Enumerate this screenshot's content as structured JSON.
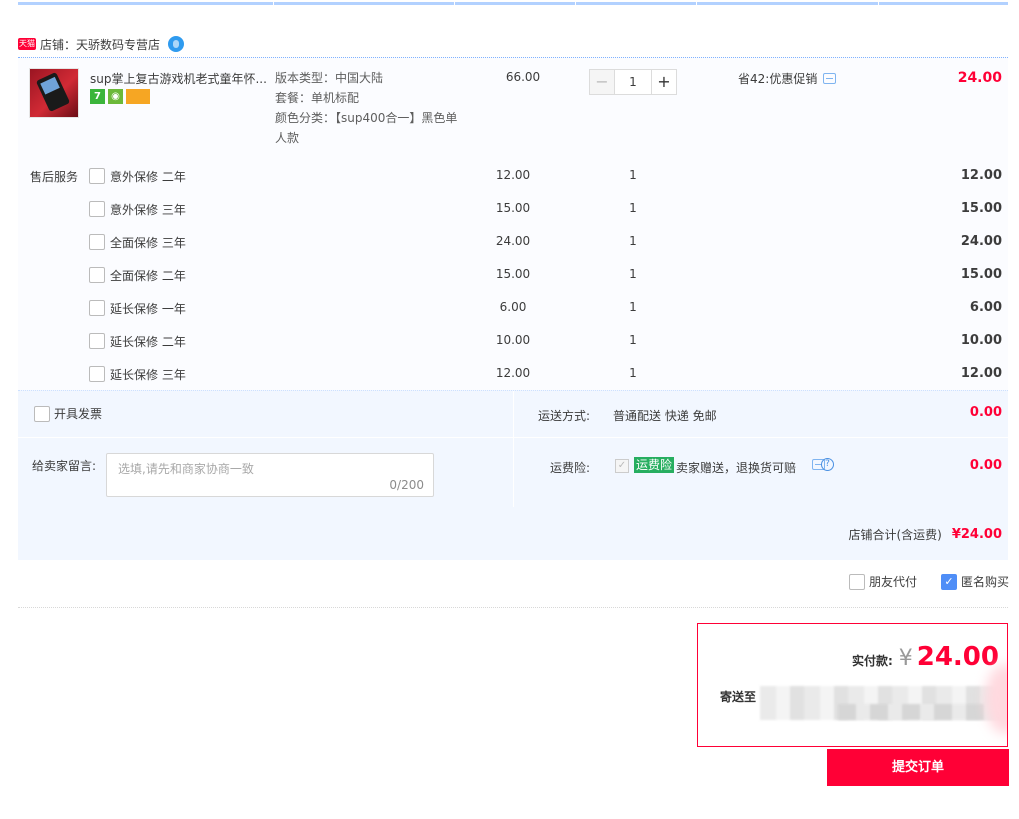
{
  "shop": {
    "prefix": "店铺：",
    "name": "天骄数码专营店",
    "tmall_badge": "天猫"
  },
  "item": {
    "title": "sup掌上复古游戏机老式童年怀...",
    "badges": [
      "7",
      "shield",
      "card"
    ],
    "props": [
      "版本类型：中国大陆",
      "套餐：单机标配",
      "颜色分类：【sup400合一】黑色单人款"
    ],
    "price": "66.00",
    "qty": "1",
    "qty_minus": "−",
    "qty_plus": "+",
    "promo": "省42:优惠促销",
    "subtotal": "24.00"
  },
  "services": {
    "label": "售后服务",
    "rows": [
      {
        "name": "意外保修 二年",
        "price": "12.00",
        "qty": "1",
        "subtotal": "12.00"
      },
      {
        "name": "意外保修 三年",
        "price": "15.00",
        "qty": "1",
        "subtotal": "15.00"
      },
      {
        "name": "全面保修 三年",
        "price": "24.00",
        "qty": "1",
        "subtotal": "24.00"
      },
      {
        "name": "全面保修 二年",
        "price": "15.00",
        "qty": "1",
        "subtotal": "15.00"
      },
      {
        "name": "延长保修 一年",
        "price": "6.00",
        "qty": "1",
        "subtotal": "6.00"
      },
      {
        "name": "延长保修 二年",
        "price": "10.00",
        "qty": "1",
        "subtotal": "10.00"
      },
      {
        "name": "延长保修 三年",
        "price": "12.00",
        "qty": "1",
        "subtotal": "12.00"
      }
    ]
  },
  "invoice": {
    "label": "开具发票"
  },
  "shipping": {
    "label": "运送方式:",
    "value": "普通配送 快递 免邮",
    "cost": "0.00"
  },
  "message": {
    "label": "给卖家留言:",
    "placeholder": "选填,请先和商家协商一致",
    "counter": "0/200"
  },
  "insurance": {
    "label": "运费险:",
    "tag": "运费险",
    "desc": "卖家赠送，退换货可赔",
    "help": "?",
    "cost": "0.00"
  },
  "shop_total": {
    "label": "店铺合计(含运费)",
    "amount": "¥24.00"
  },
  "options": {
    "friend_pay": "朋友代付",
    "anonymous": "匿名购买",
    "anonymous_checked": "✓"
  },
  "payment": {
    "label": "实付款:",
    "currency": "¥",
    "amount": "24.00",
    "ship_to": "寄送至"
  },
  "submit": {
    "label": "提交订单"
  },
  "colors": {
    "accent": "#ff0036",
    "rule": "#b2d1ff",
    "panel": "#f2f7ff"
  }
}
